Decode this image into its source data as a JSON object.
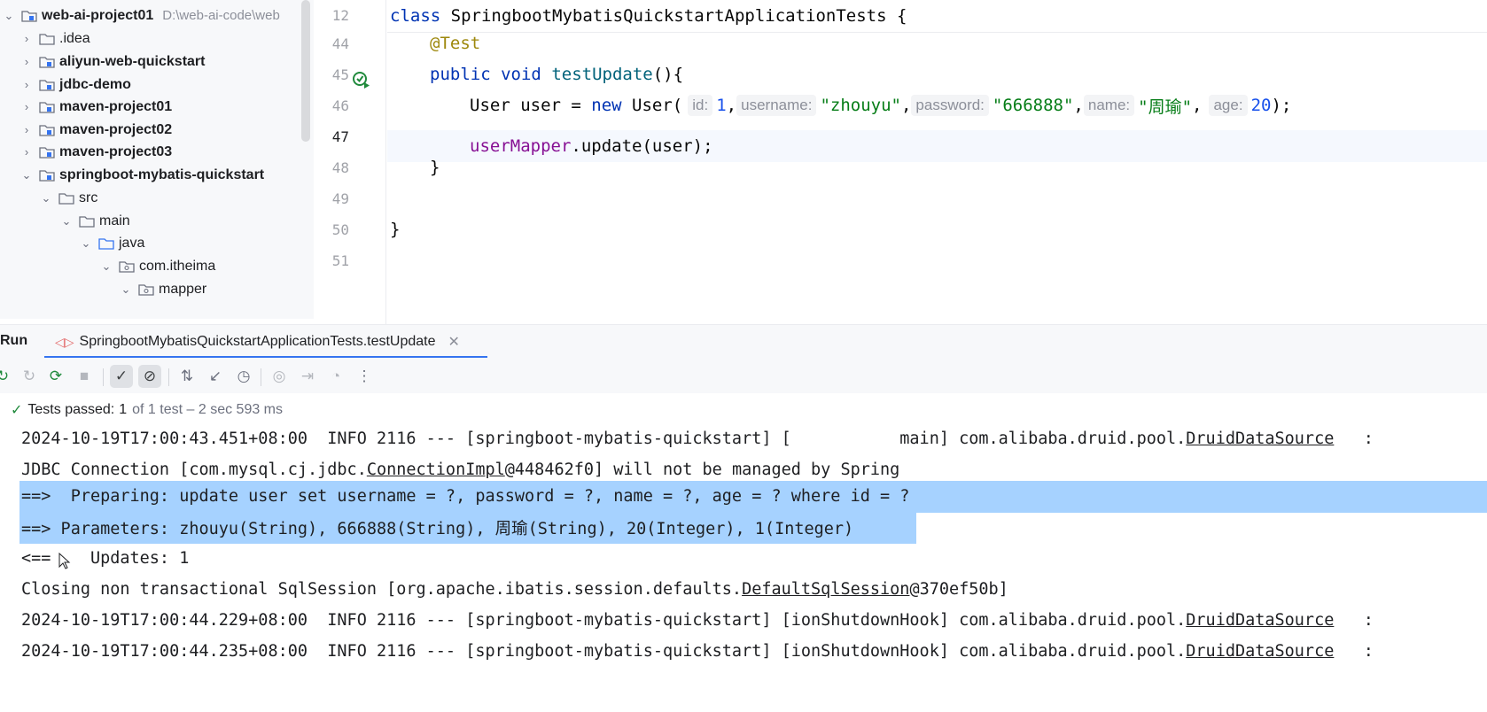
{
  "tree": {
    "root": {
      "label": "web-ai-project01",
      "path": "D:\\web-ai-code\\web"
    },
    "items": [
      {
        "label": ".idea",
        "bold": false
      },
      {
        "label": "aliyun-web-quickstart",
        "bold": true
      },
      {
        "label": "jdbc-demo",
        "bold": true
      },
      {
        "label": "maven-project01",
        "bold": true
      },
      {
        "label": "maven-project02",
        "bold": true
      },
      {
        "label": "maven-project03",
        "bold": true
      },
      {
        "label": "springboot-mybatis-quickstart",
        "bold": true
      },
      {
        "label": "src",
        "bold": false
      },
      {
        "label": "main",
        "bold": false
      },
      {
        "label": "java",
        "bold": false
      },
      {
        "label": "com.itheima",
        "bold": false
      },
      {
        "label": "mapper",
        "bold": false
      }
    ]
  },
  "editor": {
    "line_numbers": [
      "12",
      "44",
      "45",
      "46",
      "47",
      "48",
      "49",
      "50",
      "51"
    ],
    "sticky_header": {
      "kw": "class",
      "name": "SpringbootMybatisQuickstartApplicationTests",
      "brace": "{"
    },
    "annotation": "@Test",
    "method": {
      "kw1": "public",
      "kw2": "void",
      "name": "testUpdate",
      "sig": "(){"
    },
    "ctor": {
      "decl": "User user = ",
      "kw_new": "new",
      "cls": " User(",
      "hint_id": "id:",
      "val_id": "1",
      "hint_username": "username:",
      "val_username": "\"zhouyu\"",
      "hint_password": "password:",
      "val_password": "\"666888\"",
      "hint_name": "name:",
      "val_name": "\"周瑜\"",
      "hint_age": "age:",
      "val_age": "20",
      "end": ");",
      "comma": ","
    },
    "call": {
      "field": "userMapper",
      "rest": ".update(user);"
    },
    "close_method": "}",
    "close_class": "}"
  },
  "run": {
    "title": "Run",
    "tab_label": "SpringbootMybatisQuickstartApplicationTests.testUpdate",
    "status": {
      "label": "Tests passed:",
      "count": "1",
      "detail": "of 1 test – 2 sec 593 ms"
    }
  },
  "console": {
    "l1": {
      "pre": "2024-10-19T17:00:43.451+08:00  INFO 2116 --- [springboot-mybatis-quickstart] [           main] com.alibaba.druid.pool.",
      "link": "DruidDataSource",
      "post": "   :"
    },
    "l2": {
      "pre": "JDBC Connection [com.mysql.cj.jdbc.",
      "link": "ConnectionImpl",
      "post": "@448462f0] will not be managed by Spring"
    },
    "l3": "==>  Preparing: update user set username = ?, password = ?, name = ?, age = ? where id = ?",
    "l4": "==> Parameters: zhouyu(String), 666888(String), 周瑜(String), 20(Integer), 1(Integer)",
    "l5": "<==    Updates: 1",
    "l6": {
      "pre": "Closing non transactional SqlSession [org.apache.ibatis.session.defaults.",
      "link": "DefaultSqlSession",
      "post": "@370ef50b]"
    },
    "l7": {
      "pre": "2024-10-19T17:00:44.229+08:00  INFO 2116 --- [springboot-mybatis-quickstart] [ionShutdownHook] com.alibaba.druid.pool.",
      "link": "DruidDataSource",
      "post": "   :"
    },
    "l8": {
      "pre": "2024-10-19T17:00:44.235+08:00  INFO 2116 --- [springboot-mybatis-quickstart] [ionShutdownHook] com.alibaba.druid.pool.",
      "link": "DruidDataSource",
      "post": "   :"
    }
  },
  "colors": {
    "selection": "#a6d2ff",
    "tab_underline": "#3574f0",
    "passed": "#208a3c"
  }
}
